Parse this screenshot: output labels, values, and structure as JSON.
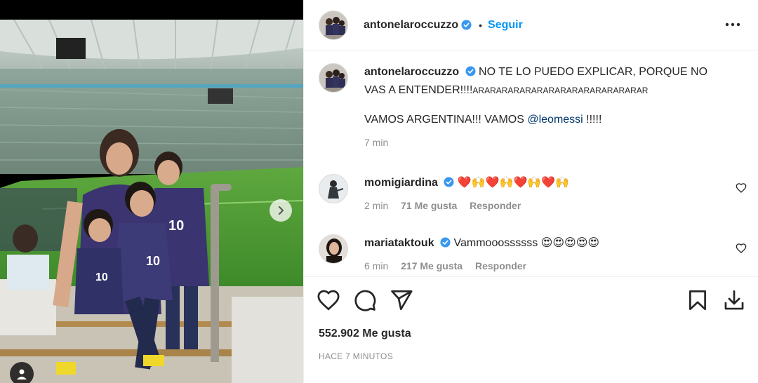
{
  "post": {
    "username": "antonelaroccuzzo",
    "follow_label": "Seguir",
    "separator": "•",
    "caption_line1": "NO TE LO PUEDO EXPLICAR, PORQUE NO VAS A ENTENDER!!!!",
    "caption_laugh": "ARARARARARARARARARARARARARARAR",
    "caption_line2_prefix": "VAMOS ARGENTINA!!! VAMOS ",
    "caption_mention": "@leomessi",
    "caption_line2_suffix": " !!!!!",
    "caption_time": "7 min",
    "likes": "552.902 Me gusta",
    "time_ago": "HACE 7 MINUTOS"
  },
  "comments": [
    {
      "username": "momigiardina",
      "text": "❤️🙌❤️🙌❤️🙌❤️🙌",
      "time": "2 min",
      "likes": "71 Me gusta",
      "reply": "Responder"
    },
    {
      "username": "mariataktouk",
      "text": "Vammooossssss 😍😍😍😍😍",
      "time": "6 min",
      "likes": "217 Me gusta",
      "reply": "Responder"
    }
  ],
  "icons": {
    "more": "more-options-icon",
    "like": "heart-icon",
    "comment": "comment-icon",
    "share": "send-icon",
    "save": "bookmark-icon",
    "download": "download-icon",
    "next": "chevron-right-icon",
    "tag": "user-tag-icon",
    "verified": "verified-badge-icon"
  },
  "colors": {
    "follow_blue": "#0095f6",
    "verified_blue": "#3897f0",
    "mention": "#00376b",
    "muted": "#8e8e8e"
  }
}
